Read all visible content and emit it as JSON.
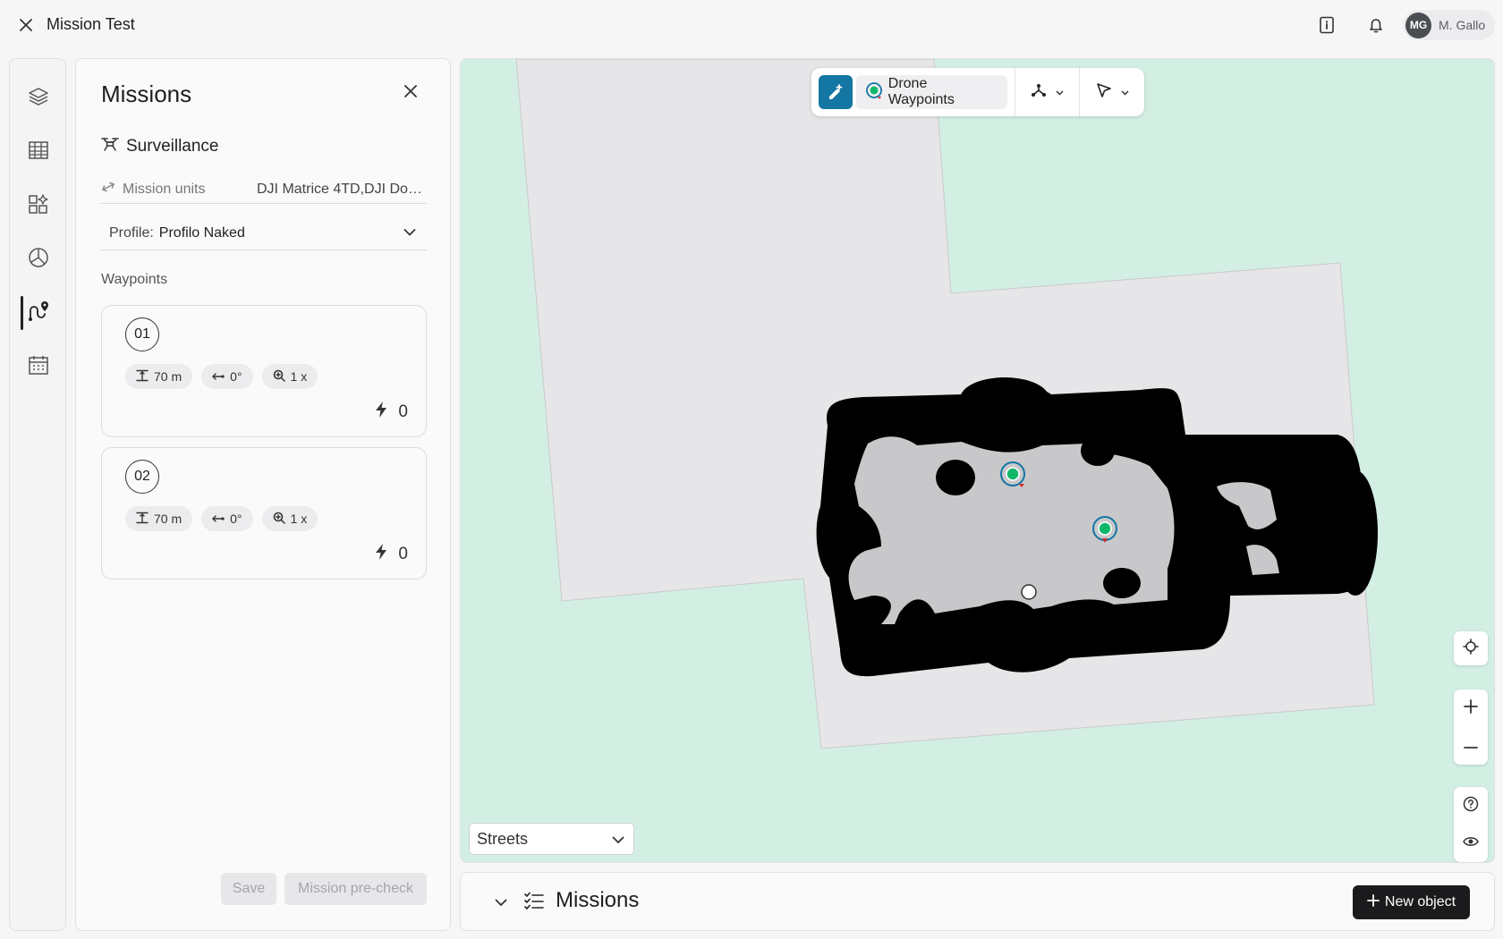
{
  "app": {
    "title": "Mission Test"
  },
  "user": {
    "initials": "MG",
    "name": "M. Gallo"
  },
  "rail": {
    "items": [
      "layers-icon",
      "table-icon",
      "widgets-icon",
      "analytics-icon",
      "mission-route-icon",
      "calendar-icon"
    ],
    "active_index": 4
  },
  "panel": {
    "title": "Missions",
    "mission_type": "Surveillance",
    "units_label": "Mission units",
    "units_value": "DJI Matrice 4TD,DJI Doc...",
    "profile_label": "Profile:",
    "profile_value": "Profilo Naked",
    "waypoints_heading": "Waypoints",
    "waypoints": [
      {
        "number": "01",
        "altitude": "70 m",
        "heading": "0°",
        "zoom": "1 x",
        "energy": "0"
      },
      {
        "number": "02",
        "altitude": "70 m",
        "heading": "0°",
        "zoom": "1 x",
        "energy": "0"
      }
    ],
    "save_label": "Save",
    "precheck_label": "Mission pre-check"
  },
  "map": {
    "toolbar": {
      "layer_label": "Drone Waypoints"
    },
    "basemap": "Streets",
    "colors": {
      "water": "#d3efe3",
      "land": "#e6e6e8",
      "mask": "#000000",
      "area": "#c8c8ca",
      "waypoint": "#12b86a",
      "accent": "#1376a3"
    }
  },
  "bottom": {
    "title": "Missions",
    "new_object_label": "New object"
  }
}
